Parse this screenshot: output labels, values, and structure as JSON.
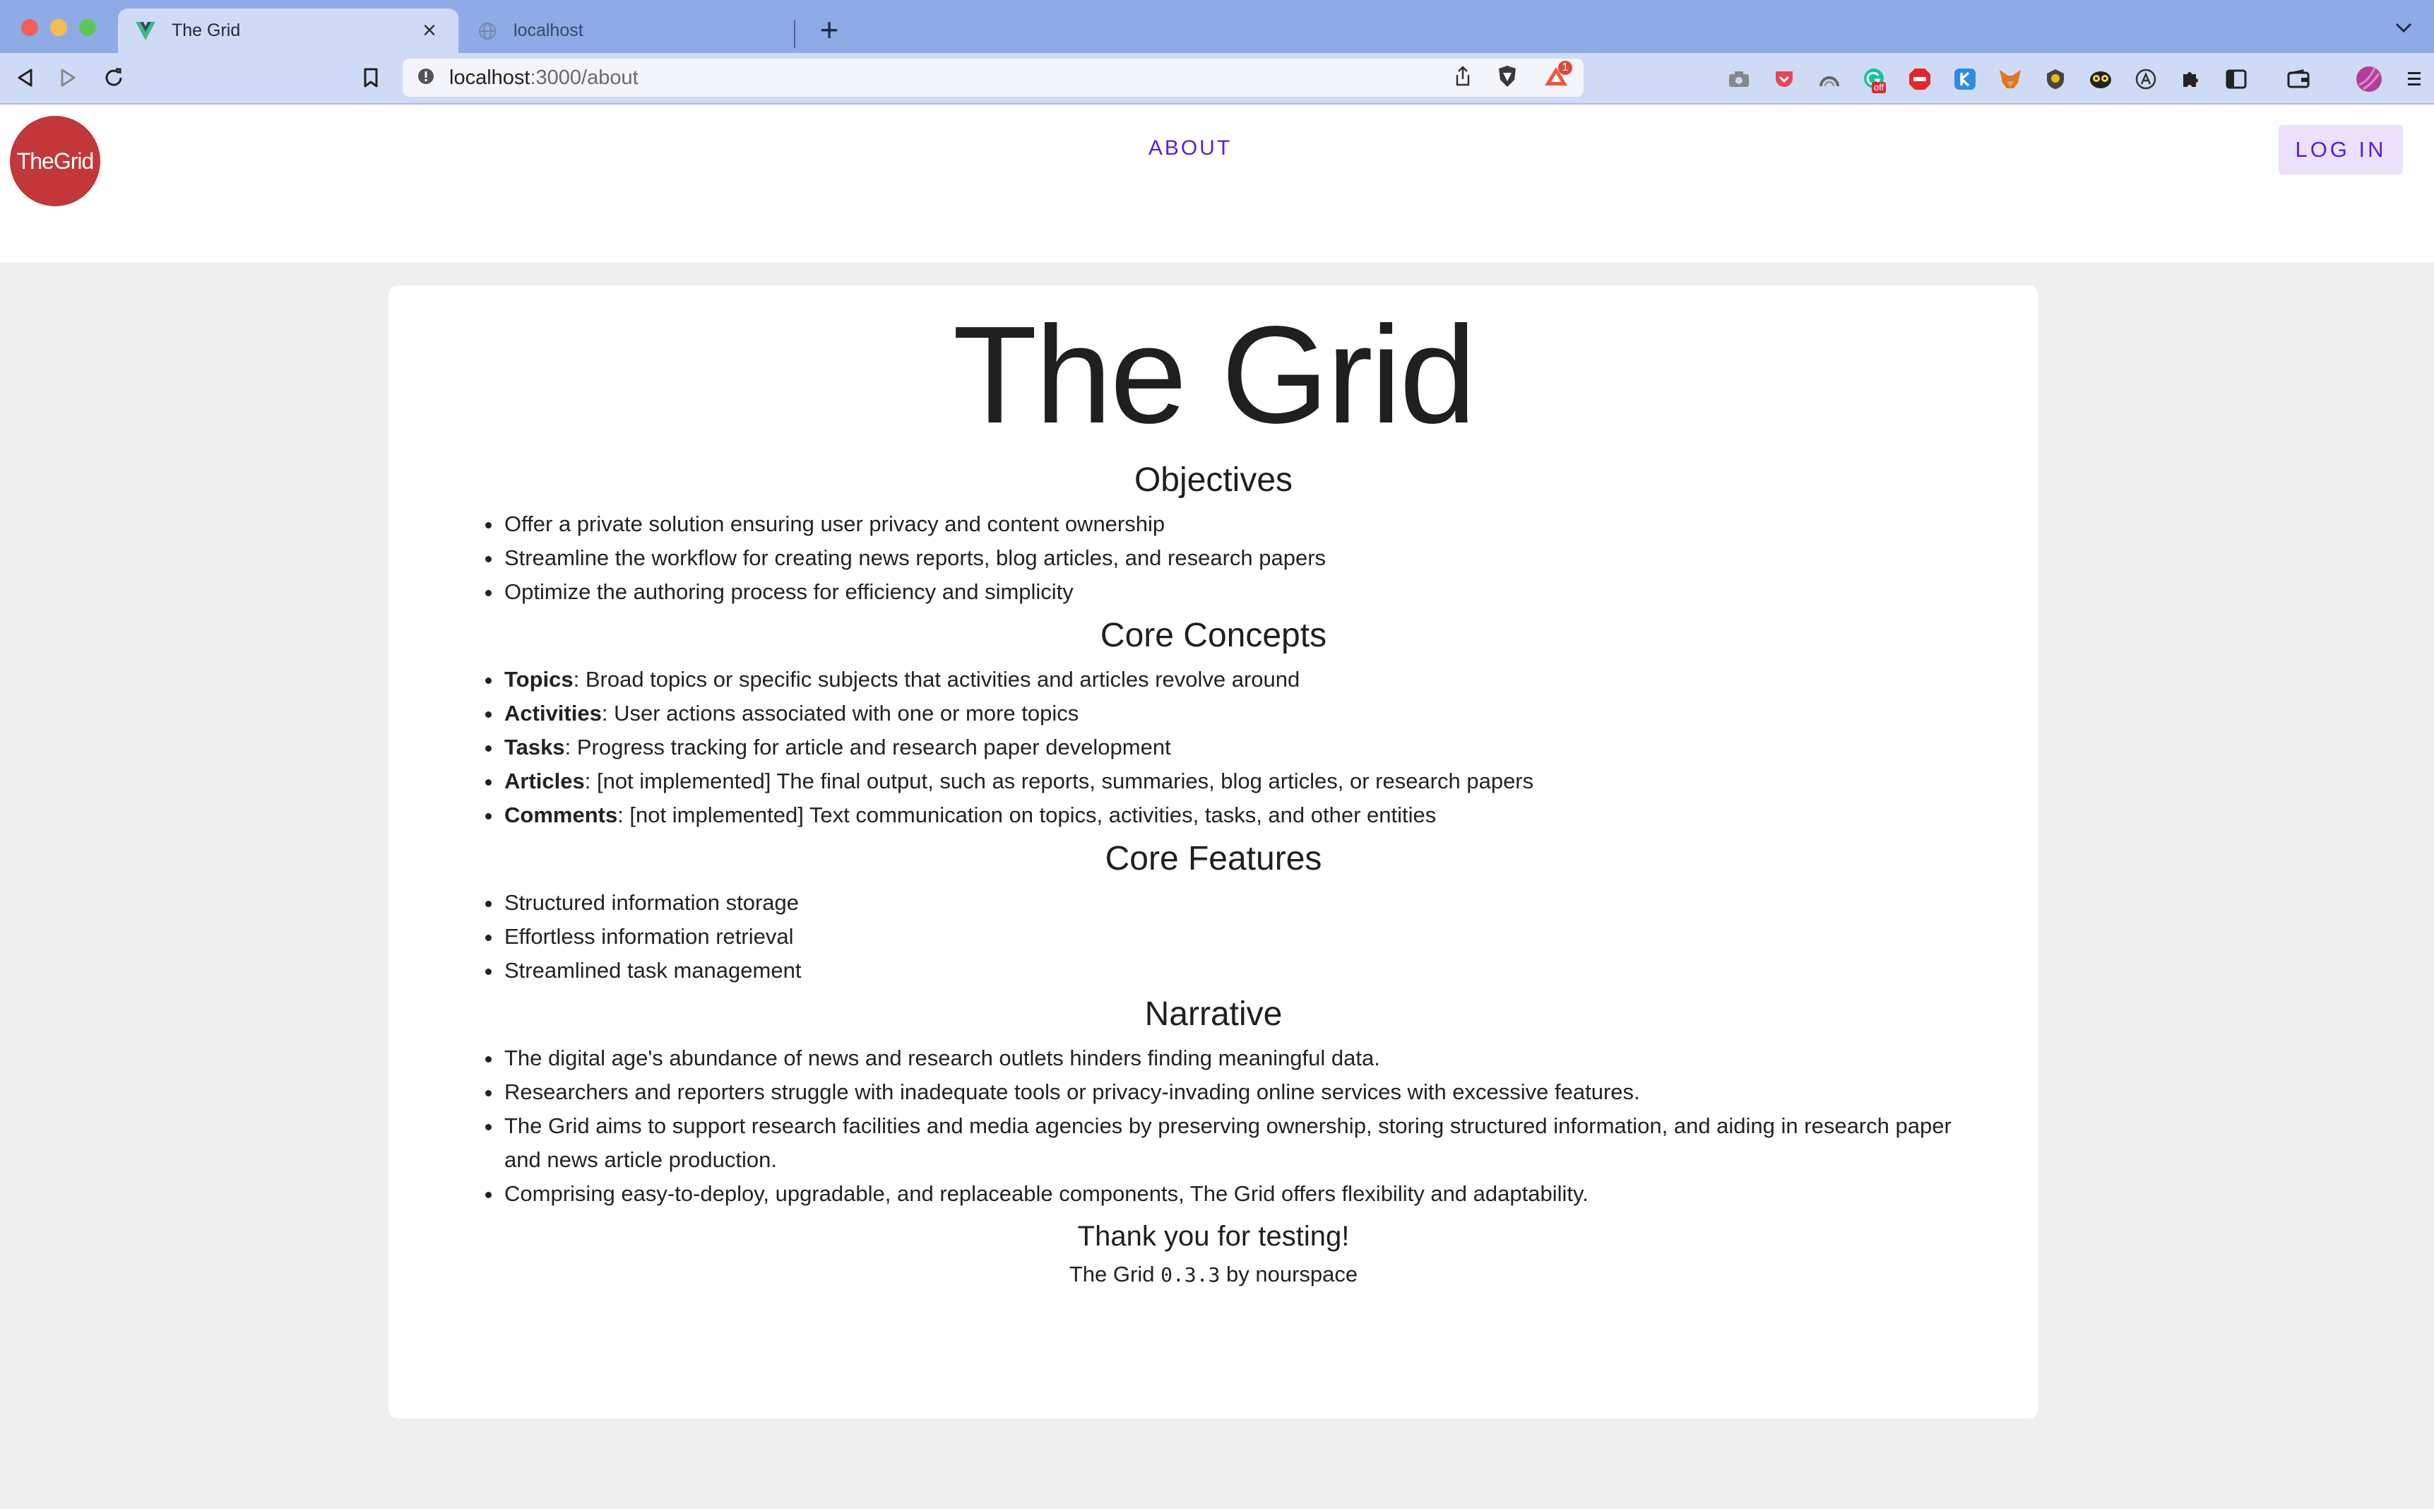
{
  "browser": {
    "tabs": [
      {
        "title": "The Grid",
        "active": true
      },
      {
        "title": "localhost",
        "active": false
      }
    ],
    "url_host": "localhost",
    "url_path": ":3000/about",
    "alert_count": "1",
    "extension_badge": "off"
  },
  "header": {
    "logo_text": "TheGrid",
    "nav_about": "ABOUT",
    "login_label": "LOG IN"
  },
  "page": {
    "title": "The Grid",
    "objectives": {
      "heading": "Objectives",
      "items": [
        "Offer a private solution ensuring user privacy and content ownership",
        "Streamline the workflow for creating news reports, blog articles, and research papers",
        "Optimize the authoring process for efficiency and simplicity"
      ]
    },
    "core_concepts": {
      "heading": "Core Concepts",
      "items": [
        {
          "term": "Topics",
          "desc": ": Broad topics or specific subjects that activities and articles revolve around"
        },
        {
          "term": "Activities",
          "desc": ": User actions associated with one or more topics"
        },
        {
          "term": "Tasks",
          "desc": ": Progress tracking for article and research paper development"
        },
        {
          "term": "Articles",
          "desc": ": [not implemented] The final output, such as reports, summaries, blog articles, or research papers"
        },
        {
          "term": "Comments",
          "desc": ": [not implemented] Text communication on topics, activities, tasks, and other entities"
        }
      ]
    },
    "core_features": {
      "heading": "Core Features",
      "items": [
        "Structured information storage",
        "Effortless information retrieval",
        "Streamlined task management"
      ]
    },
    "narrative": {
      "heading": "Narrative",
      "items": [
        "The digital age's abundance of news and research outlets hinders finding meaningful data.",
        "Researchers and reporters struggle with inadequate tools or privacy-invading online services with excessive features.",
        "The Grid aims to support research facilities and media agencies by preserving ownership, storing structured information, and aiding in research paper and news article production.",
        "Comprising easy-to-deploy, upgradable, and replaceable components, The Grid offers flexibility and adaptability."
      ]
    },
    "thanks": "Thank you for testing!",
    "footer": {
      "prefix": "The Grid ",
      "version": "0.3.3",
      "suffix": " by nourspace"
    }
  },
  "colors": {
    "tabbar": "#8eabe6",
    "toolbar": "#cfdbf5",
    "logo": "#c1373a",
    "accent": "#5a1fd1",
    "login_bg": "#ebe1fb",
    "page_bg": "#efefef"
  }
}
